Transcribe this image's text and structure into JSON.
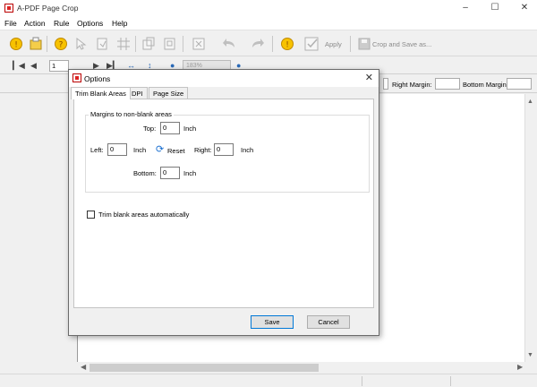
{
  "window": {
    "title": "A-PDF Page Crop"
  },
  "menu": [
    "File",
    "Action",
    "Rule",
    "Options",
    "Help"
  ],
  "toolbar": {
    "apply_label": "Apply",
    "crop_save_label": "Crop and Save as..."
  },
  "navigation": {
    "page": "1",
    "zoom": "183%"
  },
  "margins_bar": {
    "right_label": "Right Margin:",
    "bottom_label": "Bottom Margin:"
  },
  "dialog": {
    "title": "Options",
    "tabs": [
      "Trim Blank Areas",
      "DPI",
      "Page Size"
    ],
    "active_tab": "Trim Blank Areas",
    "group_title": "Margins to non-blank areas",
    "top_label": "Top:",
    "left_label": "Left:",
    "right_label": "Right:",
    "bottom_label": "Bottom:",
    "unit": "Inch",
    "reset_label": "Reset",
    "values": {
      "top": "0",
      "left": "0",
      "right": "0",
      "bottom": "0"
    },
    "trim_auto_label": "Trim blank areas automatically",
    "trim_auto_checked": false,
    "save_label": "Save",
    "cancel_label": "Cancel"
  },
  "colors": {
    "accent": "#0078d7",
    "reset_icon": "#1a6fd0",
    "app_icon": "#d22222"
  }
}
